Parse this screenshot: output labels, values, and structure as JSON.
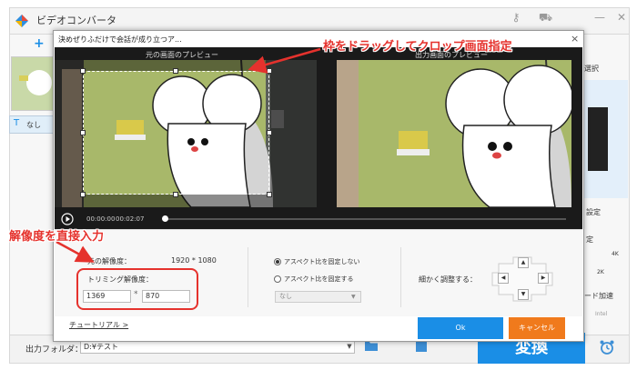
{
  "app": {
    "title": "ビデオコンバータ",
    "add_label": "+",
    "none_label": "なし",
    "right_panel": {
      "select_label": "選択",
      "settings_label": "設定",
      "fixed_label": "定",
      "quality_4k": "4K",
      "quality_2k": "2K",
      "accel_label": "ード加速",
      "intel_label": "Intel"
    },
    "bottom": {
      "folder_label": "出力フォルダ：",
      "folder_value": "D:¥テスト",
      "convert_label": "変換"
    }
  },
  "dialog": {
    "title": "決めぜりふだけで会話が成り立つア...",
    "close_label": "×",
    "preview": {
      "original_label": "元の画面のプレビュー",
      "output_label": "出力画面のプレビュー",
      "time_current": "00:00:00",
      "time_total": "00:02:07",
      "progress": 0
    },
    "settings": {
      "original_res_label": "元の解像度：",
      "original_res_value": "1920 * 1080",
      "trim_res_label": "トリミング解像度：",
      "width_value": "1369",
      "times_sign": "*",
      "height_value": "870",
      "ratio_unfixed_label": "アスペクト比を固定しない",
      "ratio_fixed_label": "アスペクト比を固定する",
      "ratio_select_value": "なし",
      "fine_adjust_label": "細かく調整する："
    },
    "tutorial_label": "チュートリアル >",
    "ok_label": "Ok",
    "cancel_label": "キャンセル"
  },
  "annotations": {
    "crop_hint": "枠をドラッグしてクロップ画面指定",
    "res_hint": "解像度を直接入力",
    "color": "#e5322d"
  },
  "icons": [
    "app-logo-icon",
    "key-icon",
    "cart-icon",
    "minimize-icon",
    "close-icon",
    "play-icon",
    "folder-icon",
    "output-folder-icon",
    "alarm-icon",
    "arrow-up-icon",
    "arrow-down-icon",
    "arrow-left-icon",
    "arrow-right-icon",
    "dropdown-icon"
  ],
  "colors": {
    "accent_blue": "#1a8ee6",
    "cancel_orange": "#f07a1c",
    "annotation_red": "#e5322d"
  }
}
